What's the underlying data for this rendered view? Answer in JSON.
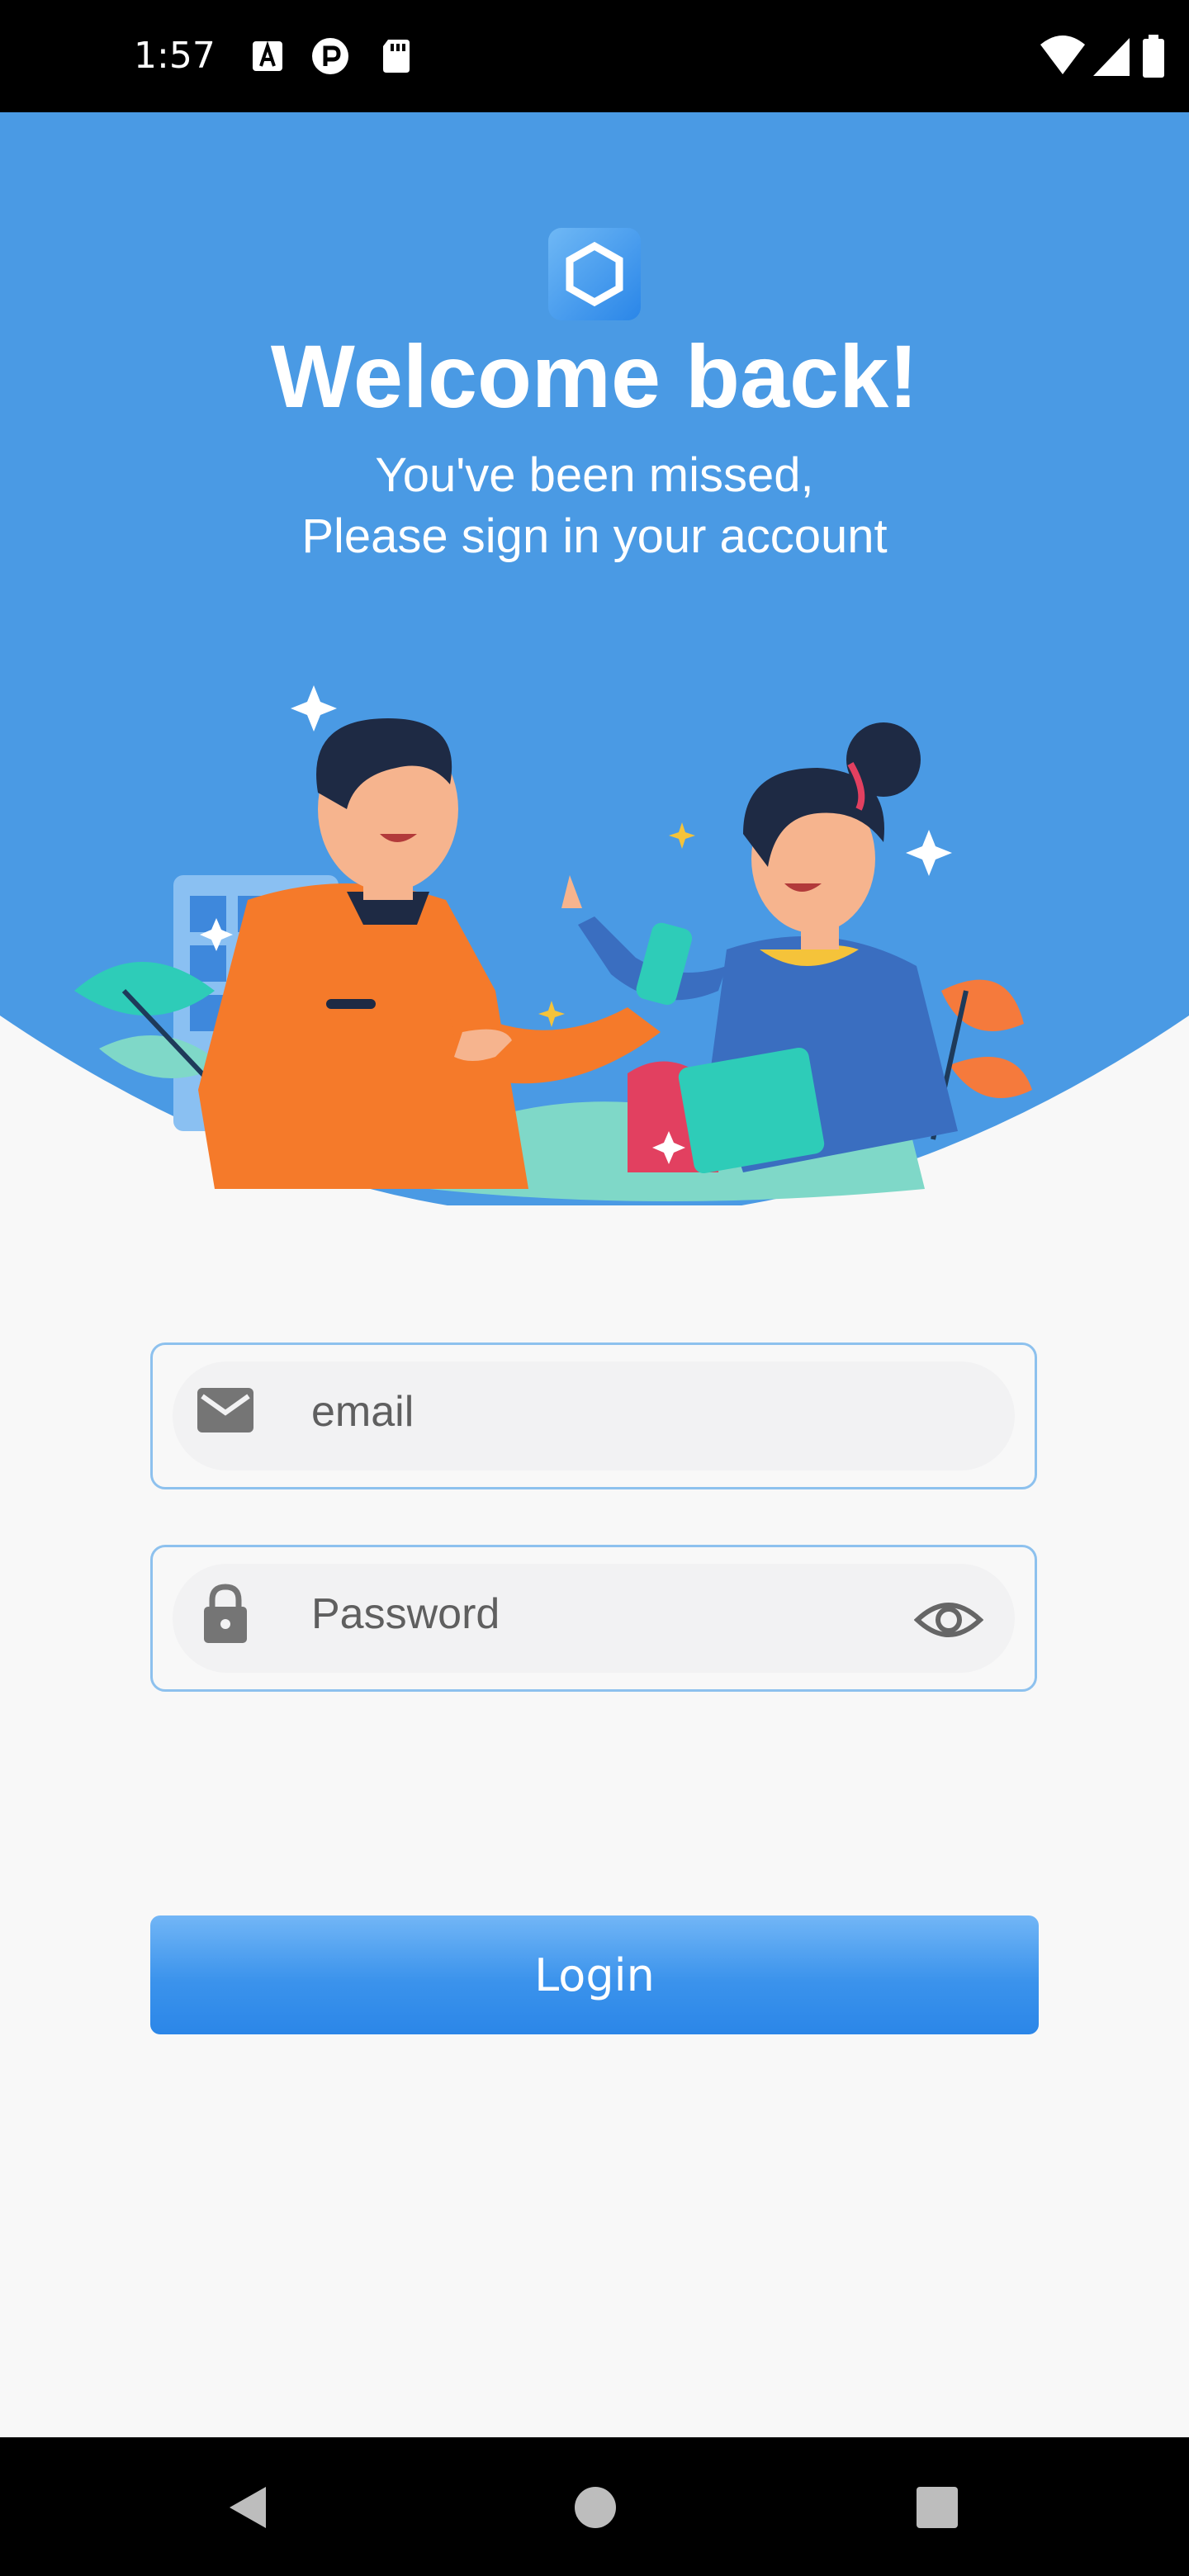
{
  "status_bar": {
    "time": "1:57",
    "icons": [
      "font-a-icon",
      "p-badge-icon",
      "sd-card-icon",
      "wifi-icon",
      "signal-icon",
      "battery-icon"
    ]
  },
  "hero": {
    "title": "Welcome back!",
    "subtitle_line1": "You've been missed,",
    "subtitle_line2": "Please sign in your account",
    "background_color": "#4A9AE4",
    "logo_icon": "hexagon-logo-icon"
  },
  "form": {
    "email_placeholder": "email",
    "email_value": "",
    "email_icon": "mail-icon",
    "password_placeholder": "Password",
    "password_value": "",
    "password_icon": "lock-icon",
    "visibility_icon": "eye-icon",
    "border_color": "#8DC1EE"
  },
  "login": {
    "label": "Login",
    "color": "#2B86E8"
  },
  "nav_bar": {
    "icons": [
      "back-triangle-icon",
      "home-circle-icon",
      "recents-square-icon"
    ]
  }
}
